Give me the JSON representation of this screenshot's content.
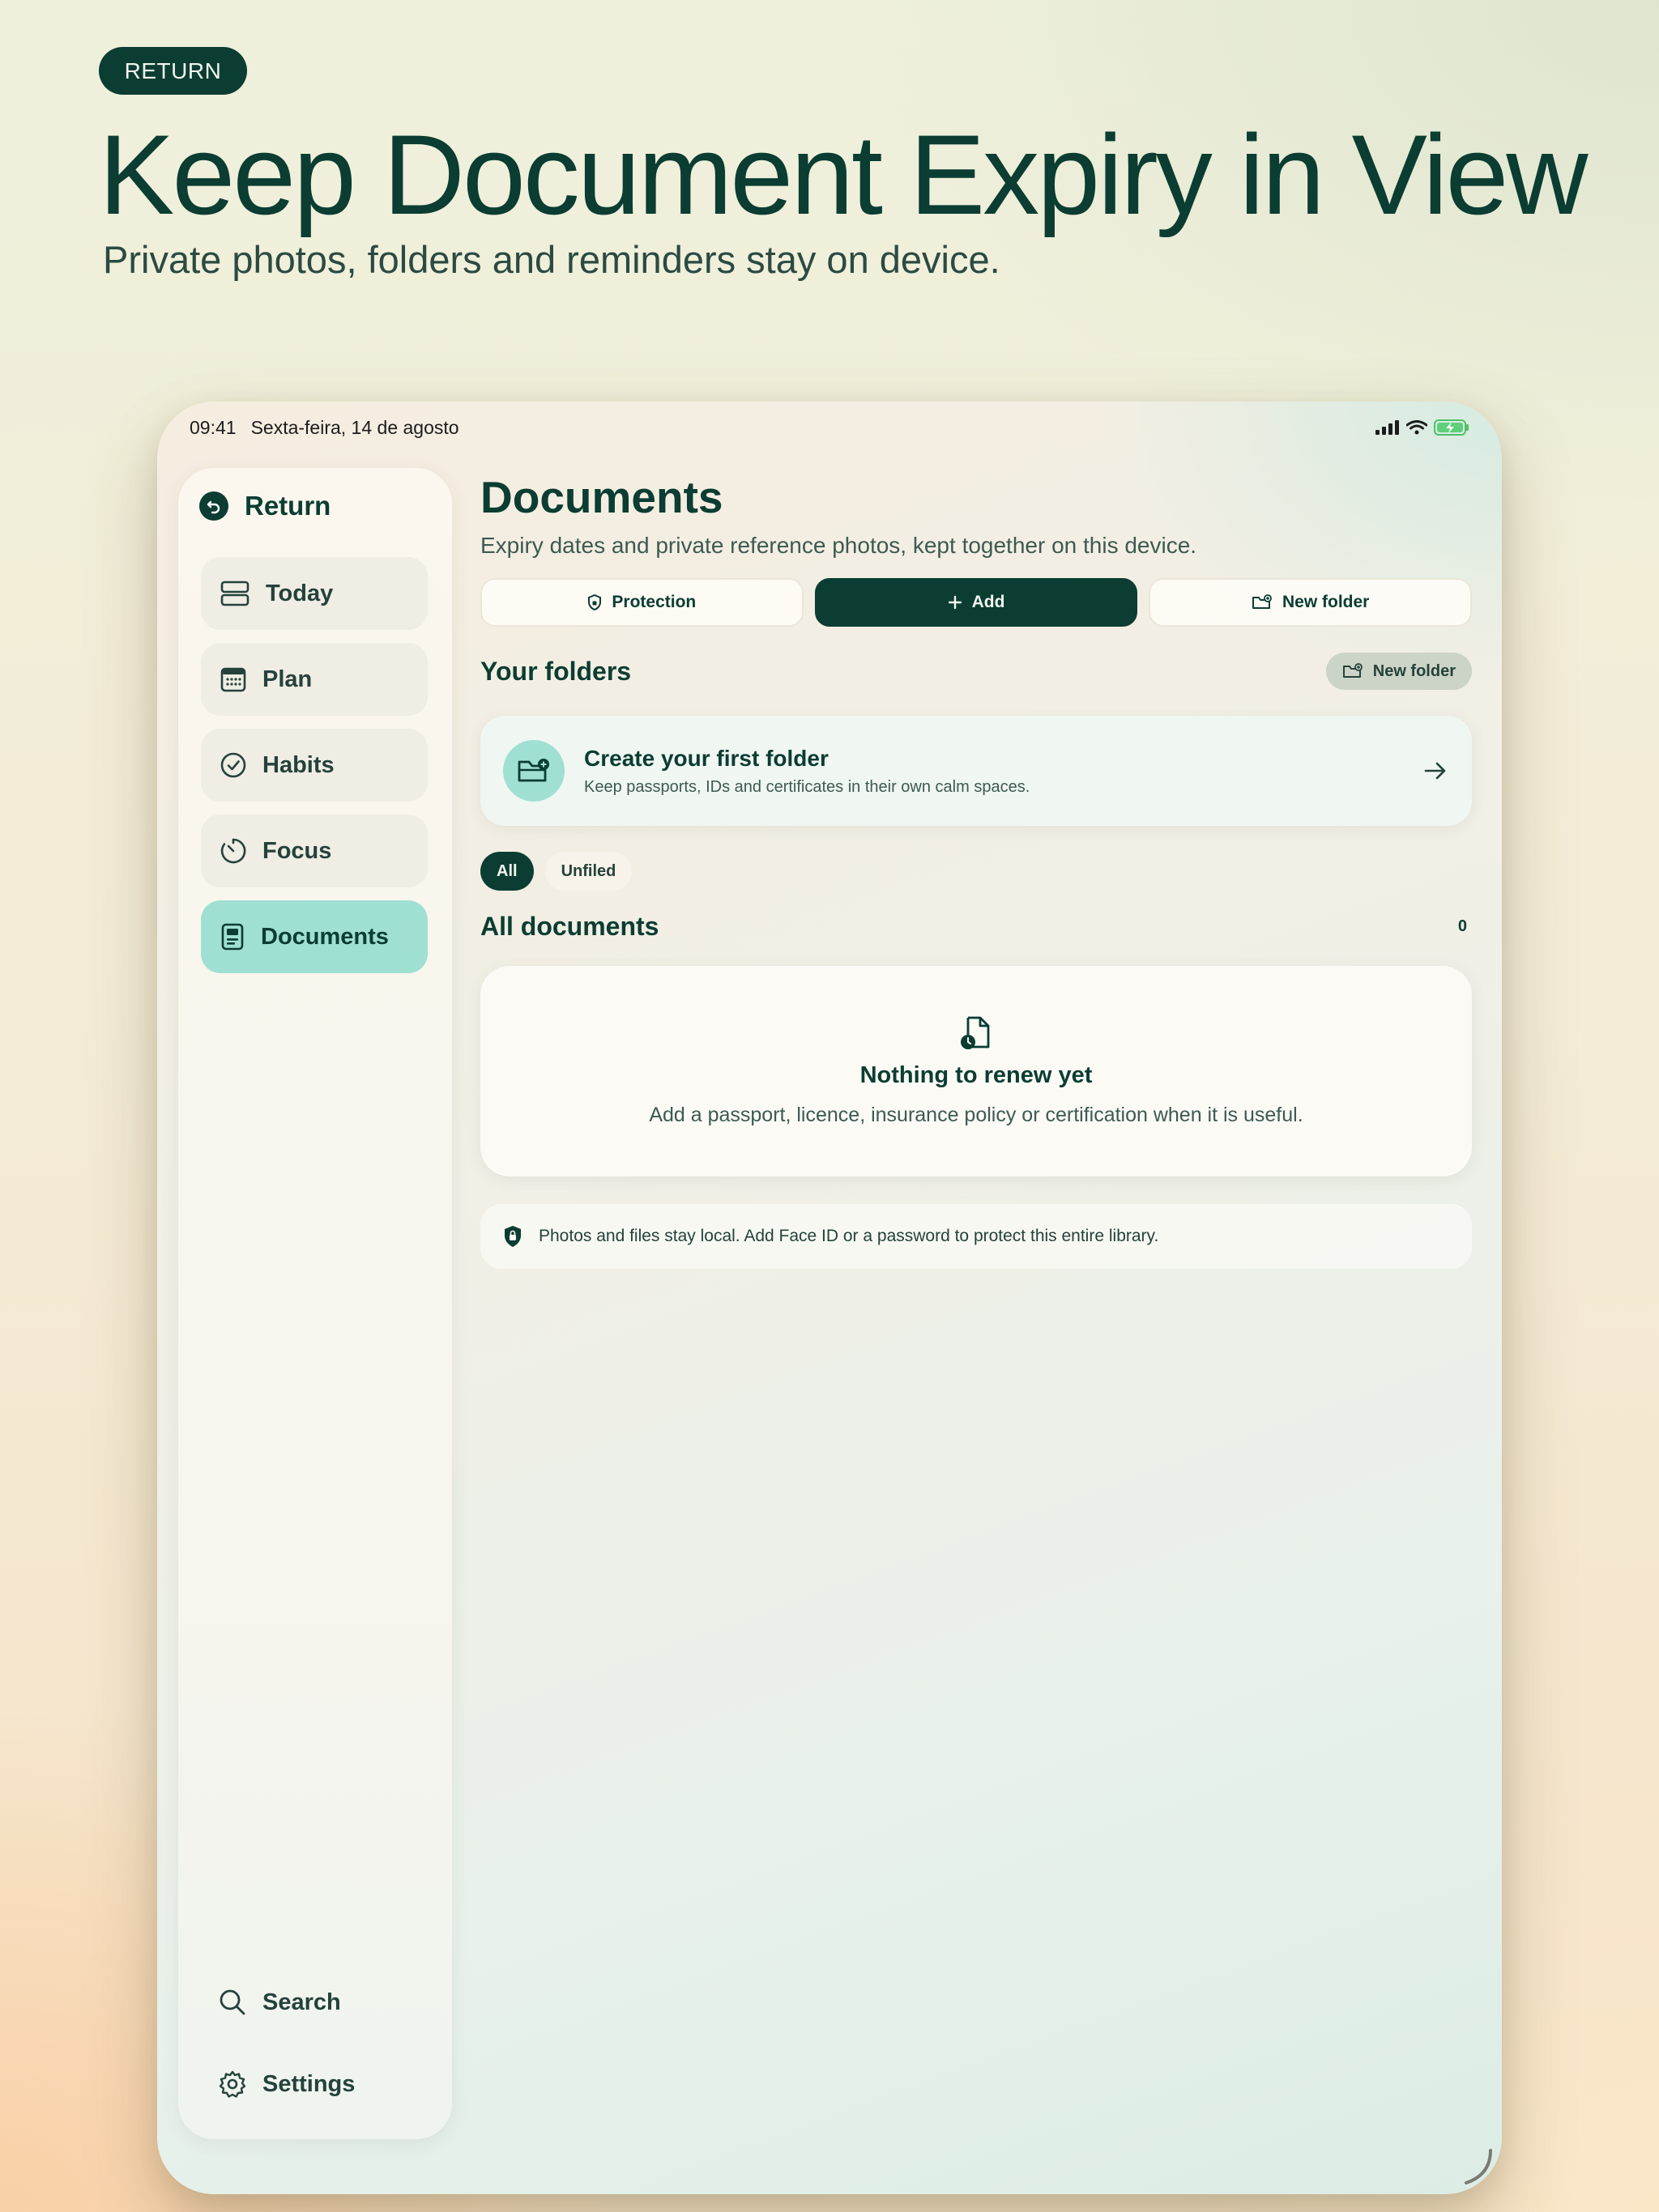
{
  "hero": {
    "badge": "RETURN",
    "title": "Keep Document Expiry in View",
    "subtitle": "Private photos, folders and reminders stay on device."
  },
  "status_bar": {
    "time": "09:41",
    "date": "Sexta-feira, 14 de agosto"
  },
  "sidebar": {
    "app_name": "Return",
    "items": [
      {
        "label": "Today",
        "icon": "rows-icon"
      },
      {
        "label": "Plan",
        "icon": "calendar-icon"
      },
      {
        "label": "Habits",
        "icon": "check-circle-icon"
      },
      {
        "label": "Focus",
        "icon": "timer-icon"
      },
      {
        "label": "Documents",
        "icon": "document-icon",
        "active": true
      }
    ],
    "search_label": "Search",
    "settings_label": "Settings"
  },
  "main": {
    "title": "Documents",
    "subtitle": "Expiry dates and private reference photos, kept together on this device.",
    "actions": {
      "protection": "Protection",
      "add": "Add",
      "new_folder": "New folder"
    },
    "folders": {
      "title": "Your folders",
      "new_folder": "New folder",
      "card_title": "Create your first folder",
      "card_sub": "Keep passports, IDs and certificates in their own calm spaces."
    },
    "filters": [
      "All",
      "Unfiled"
    ],
    "all_documents": {
      "title": "All documents",
      "count": "0"
    },
    "empty": {
      "title": "Nothing to renew yet",
      "subtitle": "Add a passport, licence, insurance policy or certification when it is useful."
    },
    "notice": "Photos and files stay local. Add Face ID or a password to protect this entire library."
  },
  "colors": {
    "accent": "#0b3d32",
    "mint": "#9fe0d3"
  }
}
